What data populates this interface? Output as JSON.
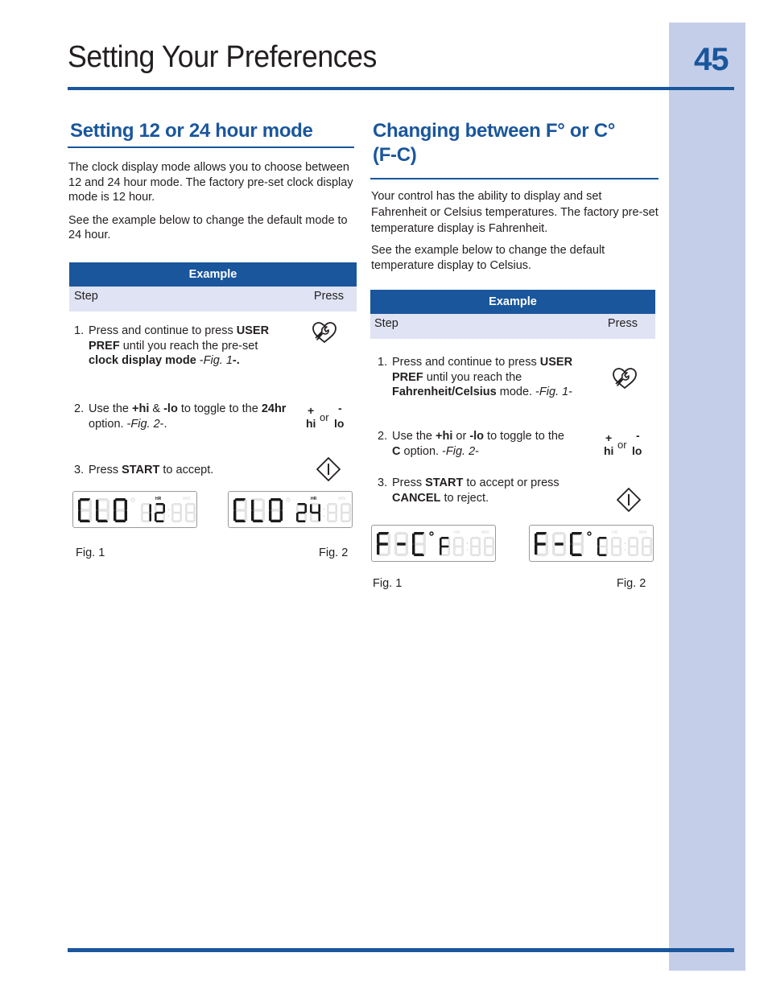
{
  "page": {
    "title": "Setting Your Preferences",
    "number": "45",
    "colors": {
      "brand_blue": "#1a569c",
      "tab_lavender": "#c5cee9",
      "table_subheader": "#dfe3f3"
    }
  },
  "sections": [
    {
      "heading": "Setting 12 or 24 hour mode",
      "paragraphs": [
        "The clock display mode allows you to choose between 12 and 24 hour mode. The factory pre-set clock display mode is 12 hour.",
        "See the example below to change the default mode to 24 hour."
      ],
      "example": {
        "header": "Example",
        "col_step": "Step",
        "col_press": "Press",
        "steps": [
          {
            "num": "1.",
            "parts": [
              [
                "Press and continue to press ",
                ""
              ],
              [
                "USER PREF",
                "b"
              ],
              [
                " until you reach the pre-set ",
                ""
              ],
              [
                "clock display mode",
                "b"
              ],
              [
                " -",
                ""
              ],
              [
                "Fig. 1",
                "i"
              ],
              [
                "-.",
                "b"
              ]
            ],
            "press_icon": "user-pref-wrench-heart-icon"
          },
          {
            "num": "2.",
            "parts": [
              [
                "Use the ",
                ""
              ],
              [
                "+hi",
                "b"
              ],
              [
                " & ",
                ""
              ],
              [
                "-lo",
                "b"
              ],
              [
                " to toggle to the ",
                ""
              ],
              [
                "24hr",
                "b"
              ],
              [
                " option. -",
                ""
              ],
              [
                "Fig. 2",
                "i"
              ],
              [
                "-.",
                ""
              ]
            ],
            "press_icon": "hi-lo-buttons"
          },
          {
            "num": "3.",
            "parts": [
              [
                "Press ",
                ""
              ],
              [
                "START",
                "b"
              ],
              [
                " to accept.",
                ""
              ]
            ],
            "press_icon": "start-diamond-icon"
          }
        ],
        "hilo": {
          "plus": "+",
          "minus": "-",
          "hi": "hi",
          "or": "or",
          "lo": "lo"
        },
        "figures": [
          {
            "caption": "Fig. 1",
            "display_main": "CLO",
            "display_value": "12",
            "label_hr": "HR",
            "label_min": "MIN"
          },
          {
            "caption": "Fig. 2",
            "display_main": "CLO",
            "display_value": "24",
            "label_hr": "HR",
            "label_min": "MIN"
          }
        ]
      }
    },
    {
      "heading_line1": "Changing between F° or C°",
      "heading_line2": "(F-C)",
      "paragraphs": [
        "Your control has the ability to display and set Fahrenheit or Celsius temperatures. The factory pre-set temperature display is Fahrenheit.",
        "See the example below to change the default temperature display to Celsius."
      ],
      "example": {
        "header": "Example",
        "col_step": "Step",
        "col_press": "Press",
        "steps": [
          {
            "num": "1.",
            "parts": [
              [
                "Press and continue to press ",
                ""
              ],
              [
                "USER PREF",
                "b"
              ],
              [
                " until you reach the ",
                ""
              ],
              [
                "Fahrenheit/Celsius",
                "b"
              ],
              [
                " mode. -",
                ""
              ],
              [
                "Fig. 1",
                "i"
              ],
              [
                "-",
                ""
              ]
            ],
            "press_icon": "user-pref-wrench-heart-icon"
          },
          {
            "num": "2.",
            "parts": [
              [
                "Use the ",
                ""
              ],
              [
                "+hi",
                "b"
              ],
              [
                " or ",
                ""
              ],
              [
                "-lo",
                "b"
              ],
              [
                " to toggle to the ",
                ""
              ],
              [
                "C",
                "b"
              ],
              [
                " option. -",
                ""
              ],
              [
                "Fig. 2",
                "i"
              ],
              [
                "-",
                ""
              ]
            ],
            "press_icon": "hi-lo-buttons"
          },
          {
            "num": "3.",
            "parts": [
              [
                "Press ",
                ""
              ],
              [
                "START",
                "b"
              ],
              [
                " to accept or press ",
                ""
              ],
              [
                "CANCEL",
                "b"
              ],
              [
                " to reject.",
                ""
              ]
            ],
            "press_icon": "start-diamond-icon"
          }
        ],
        "hilo": {
          "plus": "+",
          "minus": "-",
          "hi": "hi",
          "or": "or",
          "lo": "lo"
        },
        "figures": [
          {
            "caption": "Fig. 1",
            "display_main": "F-C",
            "display_value": "F",
            "label_hr": "HR",
            "label_min": "MIN"
          },
          {
            "caption": "Fig. 2",
            "display_main": "F-C",
            "display_value": "C",
            "label_hr": "HR",
            "label_min": "MIN"
          }
        ]
      }
    }
  ]
}
